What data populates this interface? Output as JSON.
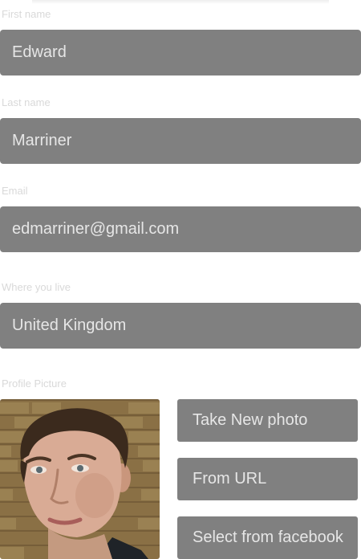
{
  "form": {
    "first_name": {
      "label": "First name",
      "value": "Edward"
    },
    "last_name": {
      "label": "Last name",
      "value": "Marriner"
    },
    "email": {
      "label": "Email",
      "value": "edmarriner@gmail.com"
    },
    "location": {
      "label": "Where you live",
      "value": "United Kingdom"
    }
  },
  "profile_picture": {
    "label": "Profile Picture",
    "buttons": {
      "take_photo": "Take New photo",
      "from_url": "From URL",
      "facebook": "Select from facebook"
    }
  },
  "colors": {
    "field_bg": "#808080",
    "field_text": "#e6e6e6",
    "label_text": "#d9d9d9"
  }
}
